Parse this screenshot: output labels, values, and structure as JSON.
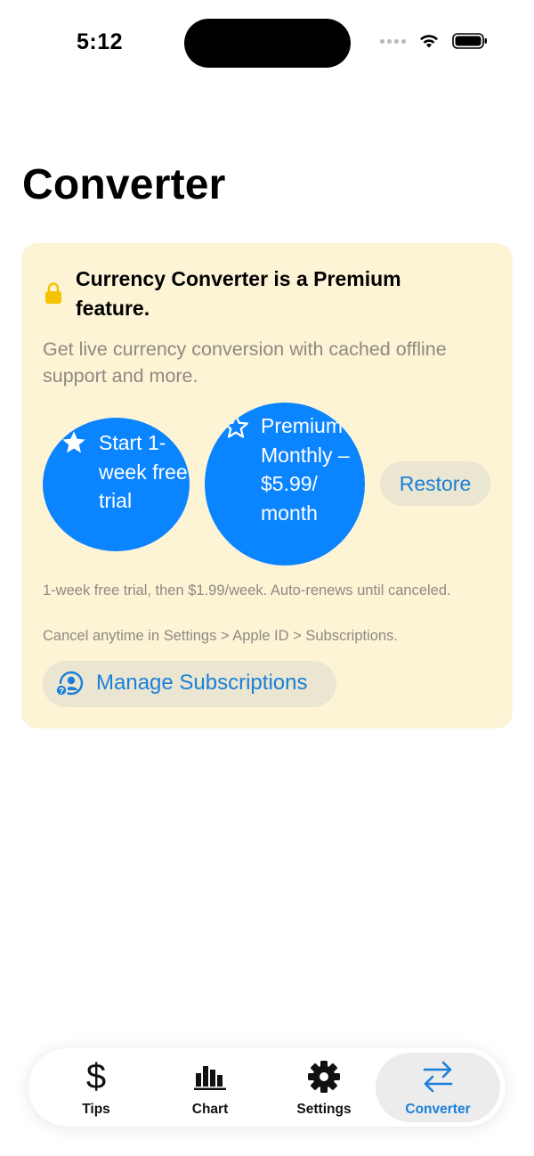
{
  "status_bar": {
    "time": "5:12"
  },
  "page": {
    "title": "Converter"
  },
  "premium_card": {
    "heading": "Currency Converter is a Premium feature.",
    "description": "Get live currency conversion with cached offline support and more.",
    "trial_button": "Start 1-week free trial",
    "monthly_button": "Premium Monthly – $5.99/ month",
    "restore_button": "Restore",
    "fine_print_1": "1-week free trial, then $1.99/week. Auto-renews until canceled.",
    "fine_print_2": "Cancel anytime in Settings > Apple ID > Subscriptions.",
    "manage_button": "Manage Subscriptions"
  },
  "tab_bar": {
    "tabs": [
      {
        "label": "Tips",
        "icon": "dollar-icon",
        "active": false
      },
      {
        "label": "Chart",
        "icon": "chart-icon",
        "active": false
      },
      {
        "label": "Settings",
        "icon": "gear-icon",
        "active": false
      },
      {
        "label": "Converter",
        "icon": "arrows-exchange-icon",
        "active": true
      }
    ]
  },
  "colors": {
    "accent": "#0a84ff",
    "link": "#1a7fd9",
    "card_background": "#fdf4d6",
    "lock": "#f5c400"
  }
}
